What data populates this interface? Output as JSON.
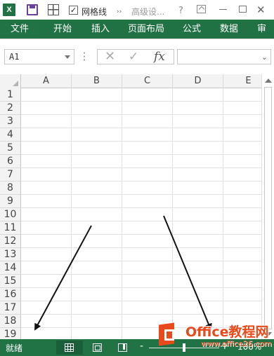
{
  "quick_access": {
    "app_icon": "excel-icon",
    "app_letter": "X",
    "gridlines_checkbox_checked": true,
    "gridlines_check_mark": "✓",
    "gridlines_label": "网格线",
    "more_label": "››",
    "advanced_label": "高级设...",
    "help_label": "?",
    "close_label": "✕"
  },
  "tabs": [
    {
      "label": "文件"
    },
    {
      "label": "开始"
    },
    {
      "label": "插入"
    },
    {
      "label": "页面布局"
    },
    {
      "label": "公式"
    },
    {
      "label": "数据"
    },
    {
      "label": "审"
    }
  ],
  "formula_bar": {
    "name_box": "A1",
    "cancel_icon": "✕",
    "enter_icon": "✓",
    "fx_label": "fx",
    "formula_value": ""
  },
  "grid": {
    "columns": [
      "A",
      "B",
      "C",
      "D",
      "E"
    ],
    "rows": [
      "1",
      "2",
      "3",
      "4",
      "5",
      "6",
      "7",
      "8",
      "9",
      "10",
      "11",
      "12",
      "13",
      "14",
      "15",
      "16",
      "17",
      "18",
      "19"
    ]
  },
  "status_bar": {
    "status_text": "就绪",
    "zoom_minus": "-",
    "zoom_plus": "+",
    "zoom_level": "100%",
    "zoom_fraction": 0.5
  },
  "watermark": {
    "title": "Office教程网",
    "url": "www.office26.com"
  },
  "colors": {
    "excel_green": "#217346",
    "watermark_orange": "#e84a1c"
  }
}
